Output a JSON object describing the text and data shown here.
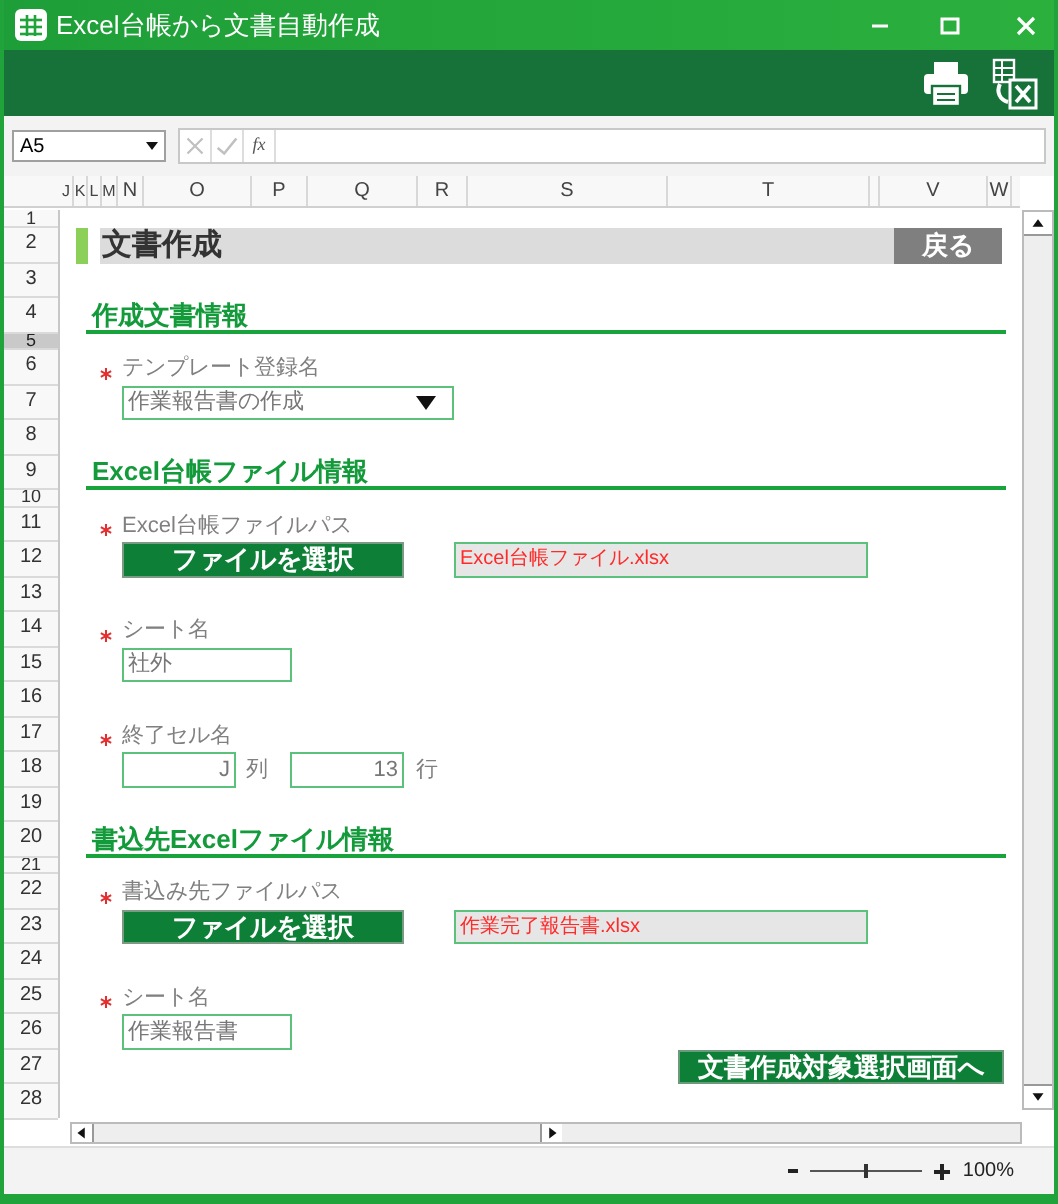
{
  "window": {
    "title": "Excel台帳から文書自動作成"
  },
  "formula_bar": {
    "name_box": "A5",
    "fx": "fx"
  },
  "column_headers": [
    "J",
    "K",
    "L",
    "M",
    "N",
    "O",
    "P",
    "Q",
    "R",
    "S",
    "T",
    "V",
    "W"
  ],
  "row_headers": [
    {
      "label": "1",
      "selected": false
    },
    {
      "label": "2",
      "selected": false
    },
    {
      "label": "3",
      "selected": false
    },
    {
      "label": "4",
      "selected": false
    },
    {
      "label": "5",
      "selected": true
    },
    {
      "label": "6",
      "selected": false
    },
    {
      "label": "7",
      "selected": false
    },
    {
      "label": "8",
      "selected": false
    },
    {
      "label": "9",
      "selected": false
    },
    {
      "label": "10",
      "selected": false
    },
    {
      "label": "11",
      "selected": false
    },
    {
      "label": "12",
      "selected": false
    },
    {
      "label": "13",
      "selected": false
    },
    {
      "label": "14",
      "selected": false
    },
    {
      "label": "15",
      "selected": false
    },
    {
      "label": "16",
      "selected": false
    },
    {
      "label": "17",
      "selected": false
    },
    {
      "label": "18",
      "selected": false
    },
    {
      "label": "19",
      "selected": false
    },
    {
      "label": "20",
      "selected": false
    },
    {
      "label": "21",
      "selected": false
    },
    {
      "label": "22",
      "selected": false
    },
    {
      "label": "23",
      "selected": false
    },
    {
      "label": "24",
      "selected": false
    },
    {
      "label": "25",
      "selected": false
    },
    {
      "label": "26",
      "selected": false
    },
    {
      "label": "27",
      "selected": false
    },
    {
      "label": "28",
      "selected": false
    }
  ],
  "page": {
    "title": "文書作成",
    "back_button": "戻る",
    "sections": [
      {
        "heading": "作成文書情報",
        "fields": [
          {
            "kind": "dropdown",
            "required": true,
            "label": "テンプレート登録名",
            "value": "作業報告書の作成"
          }
        ]
      },
      {
        "heading": "Excel台帳ファイル情報",
        "fields": [
          {
            "kind": "file",
            "required": true,
            "label": "Excel台帳ファイルパス",
            "button": "ファイルを選択",
            "path": "Excel台帳ファイル.xlsx"
          },
          {
            "kind": "text",
            "required": true,
            "label": "シート名",
            "value": "社外"
          },
          {
            "kind": "cell",
            "required": true,
            "label": "終了セル名",
            "column": "J",
            "column_unit": "列",
            "row": "13",
            "row_unit": "行"
          }
        ]
      },
      {
        "heading": "書込先Excelファイル情報",
        "fields": [
          {
            "kind": "file",
            "required": true,
            "label": "書込み先ファイルパス",
            "button": "ファイルを選択",
            "path": "作業完了報告書.xlsx"
          },
          {
            "kind": "text",
            "required": true,
            "label": "シート名",
            "value": "作業報告書"
          }
        ]
      }
    ],
    "next_button": "文書作成対象選択画面へ"
  },
  "status_bar": {
    "zoom": "100%",
    "zoom_slider": {
      "level": 0.5
    }
  }
}
